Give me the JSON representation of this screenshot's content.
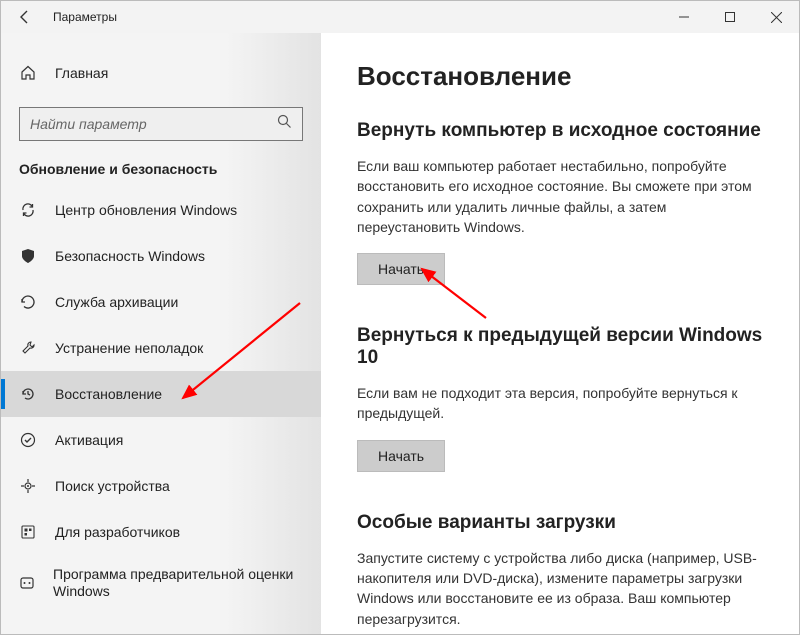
{
  "titlebar": {
    "title": "Параметры"
  },
  "sidebar": {
    "home": "Главная",
    "search_placeholder": "Найти параметр",
    "section": "Обновление и безопасность",
    "items": [
      {
        "label": "Центр обновления Windows"
      },
      {
        "label": "Безопасность Windows"
      },
      {
        "label": "Служба архивации"
      },
      {
        "label": "Устранение неполадок"
      },
      {
        "label": "Восстановление"
      },
      {
        "label": "Активация"
      },
      {
        "label": "Поиск устройства"
      },
      {
        "label": "Для разработчиков"
      },
      {
        "label": "Программа предварительной оценки Windows"
      }
    ]
  },
  "content": {
    "heading": "Восстановление",
    "reset": {
      "title": "Вернуть компьютер в исходное состояние",
      "desc": "Если ваш компьютер работает нестабильно, попробуйте восстановить его исходное состояние. Вы сможете при этом сохранить или удалить личные файлы, а затем переустановить Windows.",
      "button": "Начать"
    },
    "goback": {
      "title": "Вернуться к предыдущей версии Windows 10",
      "desc": "Если вам не подходит эта версия, попробуйте вернуться к предыдущей.",
      "button": "Начать"
    },
    "advanced": {
      "title": "Особые варианты загрузки",
      "desc": "Запустите систему с устройства либо диска (например, USB-накопителя или DVD-диска), измените параметры загрузки Windows или восстановите ее из образа. Ваш компьютер перезагрузится."
    }
  }
}
